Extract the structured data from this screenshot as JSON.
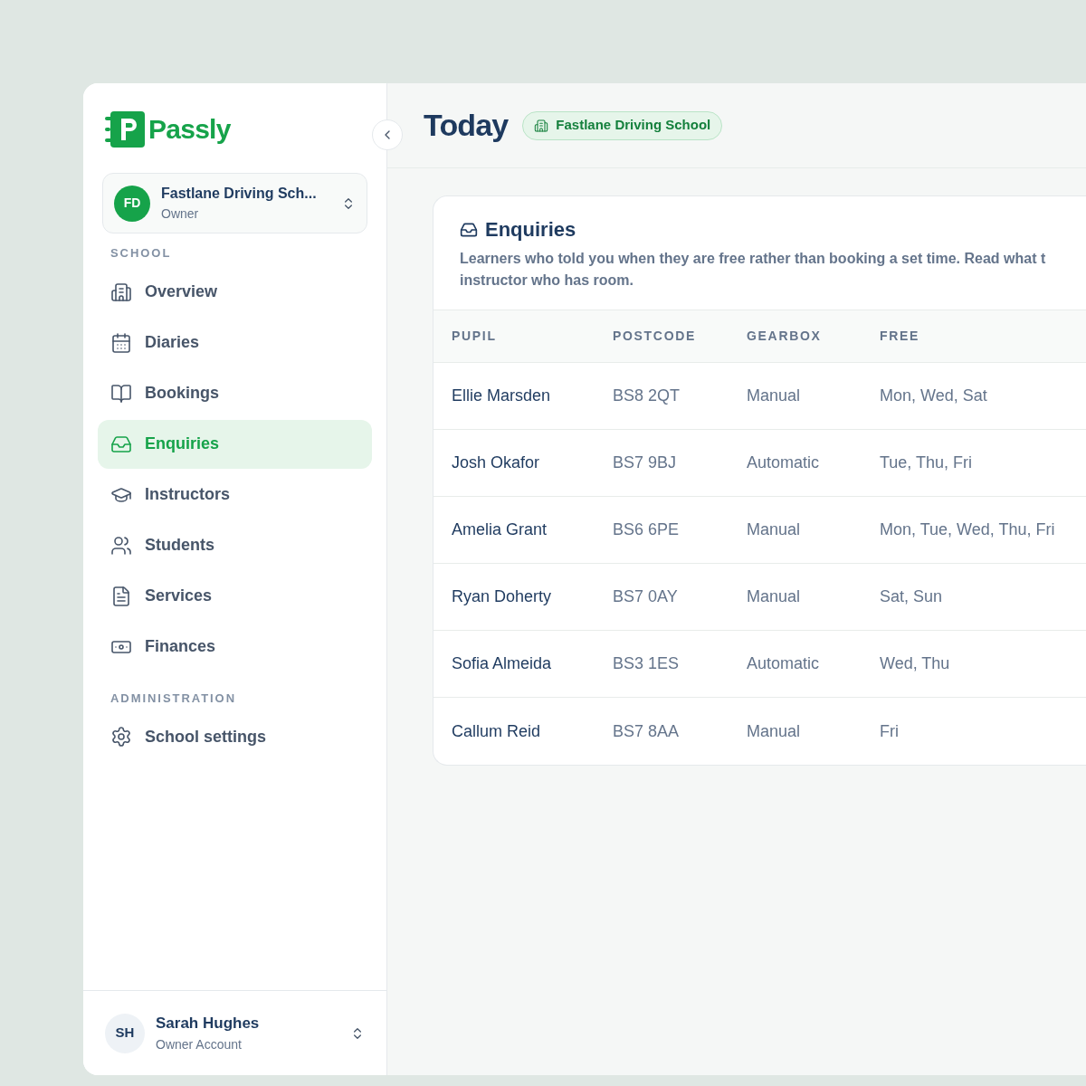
{
  "sidebar": {
    "logo": "Passly",
    "account": {
      "initials": "FD",
      "name": "Fastlane Driving Sch...",
      "role": "Owner"
    },
    "sections": [
      {
        "heading": "SCHOOL",
        "items": [
          {
            "label": "Overview",
            "selected": false
          },
          {
            "label": "Diaries",
            "selected": false
          },
          {
            "label": "Bookings",
            "selected": false
          },
          {
            "label": "Enquiries",
            "selected": true
          },
          {
            "label": "Instructors",
            "selected": false
          },
          {
            "label": "Students",
            "selected": false
          },
          {
            "label": "Services",
            "selected": false
          },
          {
            "label": "Finances",
            "selected": false
          }
        ]
      },
      {
        "heading": "ADMINISTRATION",
        "items": [
          {
            "label": "School settings",
            "selected": false
          }
        ]
      }
    ],
    "user": {
      "initials": "SH",
      "name": "Sarah Hughes",
      "role": "Owner Account"
    }
  },
  "header": {
    "title": "Today",
    "badge": "Fastlane Driving School"
  },
  "card": {
    "title": "Enquiries",
    "description_lines": [
      "Learners who told you when they are free rather than booking a set time. Read what t",
      "instructor who has room."
    ],
    "table": {
      "columns": [
        "PUPIL",
        "POSTCODE",
        "GEARBOX",
        "FREE"
      ],
      "rows": [
        [
          "Ellie Marsden",
          "BS8 2QT",
          "Manual",
          "Mon, Wed, Sat"
        ],
        [
          "Josh Okafor",
          "BS7 9BJ",
          "Automatic",
          "Tue, Thu, Fri"
        ],
        [
          "Amelia Grant",
          "BS6 6PE",
          "Manual",
          "Mon, Tue, Wed, Thu, Fri"
        ],
        [
          "Ryan Doherty",
          "BS7 0AY",
          "Manual",
          "Sat, Sun"
        ],
        [
          "Sofia Almeida",
          "BS3 1ES",
          "Automatic",
          "Wed, Thu"
        ],
        [
          "Callum Reid",
          "BS7 8AA",
          "Manual",
          "Fri"
        ]
      ]
    }
  }
}
